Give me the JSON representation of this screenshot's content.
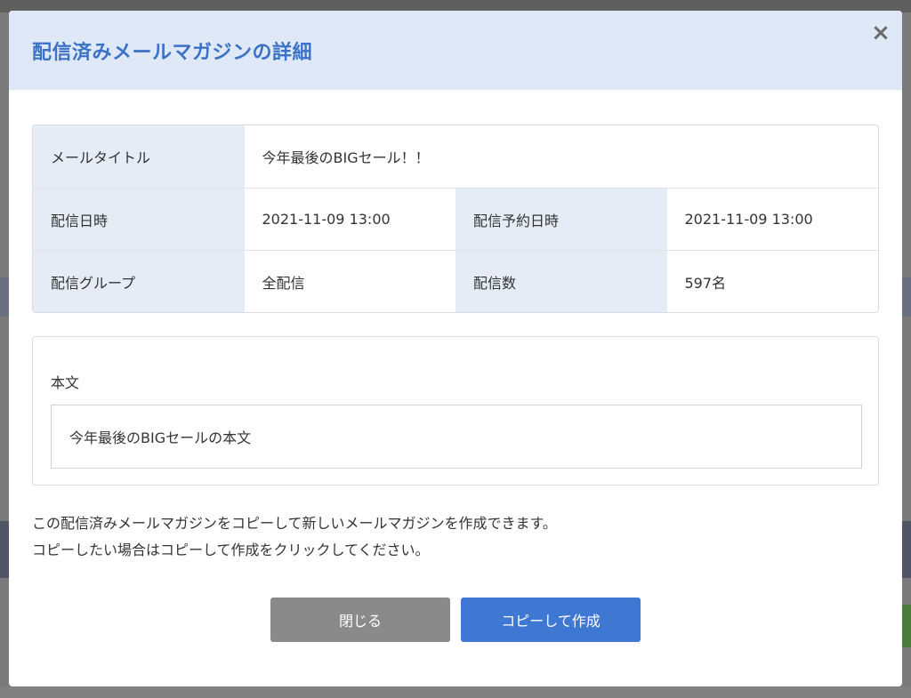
{
  "modal": {
    "title": "配信済みメールマガジンの詳細",
    "close_symbol": "×"
  },
  "details": {
    "mail_title_label": "メールタイトル",
    "mail_title_value": "今年最後のBIGセール！！",
    "sent_at_label": "配信日時",
    "sent_at_value": "2021-11-09 13:00",
    "scheduled_at_label": "配信予約日時",
    "scheduled_at_value": "2021-11-09 13:00",
    "group_label": "配信グループ",
    "group_value": "全配信",
    "count_label": "配信数",
    "count_value": "597名"
  },
  "body": {
    "label": "本文",
    "content": "今年最後のBIGセールの本文"
  },
  "note": {
    "line1": "この配信済みメールマガジンをコピーして新しいメールマガジンを作成できます。",
    "line2": "コピーしたい場合はコピーして作成をクリックしてください。"
  },
  "buttons": {
    "close_label": "閉じる",
    "copy_label": "コピーして作成"
  },
  "colors": {
    "accent": "#3f78d3",
    "header_bg": "#dfe8f6",
    "label_bg": "#e5ecf5",
    "close_button": "#8a8a8a"
  }
}
